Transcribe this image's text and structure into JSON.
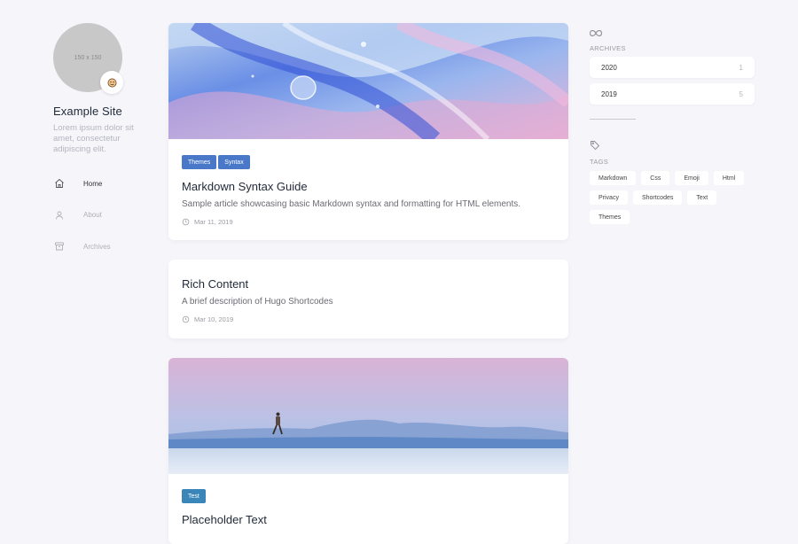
{
  "site": {
    "avatar_text": "150 x 150",
    "title": "Example Site",
    "description": "Lorem ipsum dolor sit amet, consectetur adipiscing elit."
  },
  "menu": [
    {
      "label": "Home",
      "icon": "home-icon",
      "active": true
    },
    {
      "label": "About",
      "icon": "user-icon",
      "active": false
    },
    {
      "label": "Archives",
      "icon": "archive-icon",
      "active": false
    }
  ],
  "posts": [
    {
      "categories": [
        {
          "label": "Themes",
          "color": "#4a78c8"
        },
        {
          "label": "Syntax",
          "color": "#4a78c8"
        }
      ],
      "title": "Markdown Syntax Guide",
      "description": "Sample article showcasing basic Markdown syntax and formatting for HTML elements.",
      "date": "Mar 11, 2019",
      "image": "abstract-fluid-art"
    },
    {
      "title": "Rich Content",
      "description": "A brief description of Hugo Shortcodes",
      "date": "Mar 10, 2019"
    },
    {
      "categories": [
        {
          "label": "Test",
          "color": "#3a86b8"
        }
      ],
      "title": "Placeholder Text",
      "image": "person-walking-desert"
    }
  ],
  "archives": {
    "label": "ARCHIVES",
    "icon": "infinity-icon",
    "items": [
      {
        "year": "2020",
        "count": "1"
      },
      {
        "year": "2019",
        "count": "5"
      }
    ]
  },
  "tags": {
    "label": "TAGS",
    "icon": "tag-icon",
    "items": [
      "Markdown",
      "Css",
      "Emoji",
      "Html",
      "Privacy",
      "Shortcodes",
      "Text",
      "Themes"
    ]
  },
  "colors": {
    "background": "#f5f5fa",
    "accent": "#4a78c8"
  }
}
